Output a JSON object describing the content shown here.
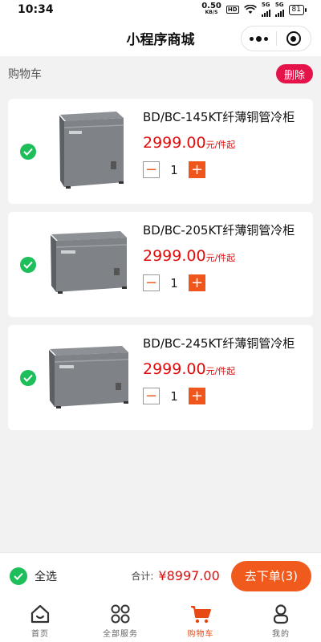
{
  "status_bar": {
    "time": "10:34",
    "speed_value": "0.50",
    "speed_unit": "KB/S",
    "hd": "HD",
    "net_1": "5G",
    "net_2": "5G",
    "battery": "81"
  },
  "nav": {
    "title": "小程序商城"
  },
  "cart": {
    "label": "购物车",
    "delete_label": "删除",
    "items": [
      {
        "title": "BD/BC-145KT纤薄铜管冷柜",
        "price": "2999.00",
        "unit": "元/件起",
        "qty": "1",
        "selected": true
      },
      {
        "title": "BD/BC-205KT纤薄铜管冷柜",
        "price": "2999.00",
        "unit": "元/件起",
        "qty": "1",
        "selected": true
      },
      {
        "title": "BD/BC-245KT纤薄铜管冷柜",
        "price": "2999.00",
        "unit": "元/件起",
        "qty": "1",
        "selected": true
      }
    ],
    "minus_symbol": "−",
    "plus_symbol": "+"
  },
  "settle": {
    "select_all_label": "全选",
    "total_label": "合计:",
    "total_value": "¥8997.00",
    "checkout_label": "去下单(3)"
  },
  "tabbar": {
    "tabs": [
      {
        "label": "首页",
        "icon": "home-icon",
        "active": false
      },
      {
        "label": "全部服务",
        "icon": "grid-icon",
        "active": false
      },
      {
        "label": "购物车",
        "icon": "cart-icon",
        "active": true
      },
      {
        "label": "我的",
        "icon": "user-icon",
        "active": false
      }
    ]
  },
  "colors": {
    "accent": "#f0561b",
    "price_red": "#e00b0b",
    "check_green": "#1ebe5b",
    "delete_red": "#e4144a"
  }
}
